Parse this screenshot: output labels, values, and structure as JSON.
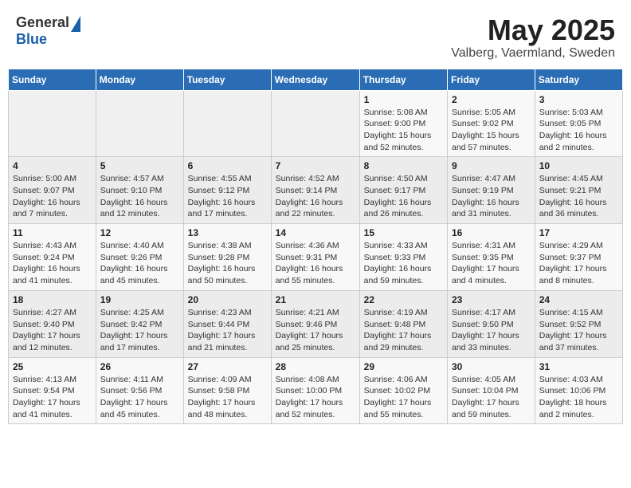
{
  "header": {
    "logo_general": "General",
    "logo_blue": "Blue",
    "title": "May 2025",
    "location": "Valberg, Vaermland, Sweden"
  },
  "days_of_week": [
    "Sunday",
    "Monday",
    "Tuesday",
    "Wednesday",
    "Thursday",
    "Friday",
    "Saturday"
  ],
  "weeks": [
    [
      {
        "day": "",
        "info": ""
      },
      {
        "day": "",
        "info": ""
      },
      {
        "day": "",
        "info": ""
      },
      {
        "day": "",
        "info": ""
      },
      {
        "day": "1",
        "info": "Sunrise: 5:08 AM\nSunset: 9:00 PM\nDaylight: 15 hours\nand 52 minutes."
      },
      {
        "day": "2",
        "info": "Sunrise: 5:05 AM\nSunset: 9:02 PM\nDaylight: 15 hours\nand 57 minutes."
      },
      {
        "day": "3",
        "info": "Sunrise: 5:03 AM\nSunset: 9:05 PM\nDaylight: 16 hours\nand 2 minutes."
      }
    ],
    [
      {
        "day": "4",
        "info": "Sunrise: 5:00 AM\nSunset: 9:07 PM\nDaylight: 16 hours\nand 7 minutes."
      },
      {
        "day": "5",
        "info": "Sunrise: 4:57 AM\nSunset: 9:10 PM\nDaylight: 16 hours\nand 12 minutes."
      },
      {
        "day": "6",
        "info": "Sunrise: 4:55 AM\nSunset: 9:12 PM\nDaylight: 16 hours\nand 17 minutes."
      },
      {
        "day": "7",
        "info": "Sunrise: 4:52 AM\nSunset: 9:14 PM\nDaylight: 16 hours\nand 22 minutes."
      },
      {
        "day": "8",
        "info": "Sunrise: 4:50 AM\nSunset: 9:17 PM\nDaylight: 16 hours\nand 26 minutes."
      },
      {
        "day": "9",
        "info": "Sunrise: 4:47 AM\nSunset: 9:19 PM\nDaylight: 16 hours\nand 31 minutes."
      },
      {
        "day": "10",
        "info": "Sunrise: 4:45 AM\nSunset: 9:21 PM\nDaylight: 16 hours\nand 36 minutes."
      }
    ],
    [
      {
        "day": "11",
        "info": "Sunrise: 4:43 AM\nSunset: 9:24 PM\nDaylight: 16 hours\nand 41 minutes."
      },
      {
        "day": "12",
        "info": "Sunrise: 4:40 AM\nSunset: 9:26 PM\nDaylight: 16 hours\nand 45 minutes."
      },
      {
        "day": "13",
        "info": "Sunrise: 4:38 AM\nSunset: 9:28 PM\nDaylight: 16 hours\nand 50 minutes."
      },
      {
        "day": "14",
        "info": "Sunrise: 4:36 AM\nSunset: 9:31 PM\nDaylight: 16 hours\nand 55 minutes."
      },
      {
        "day": "15",
        "info": "Sunrise: 4:33 AM\nSunset: 9:33 PM\nDaylight: 16 hours\nand 59 minutes."
      },
      {
        "day": "16",
        "info": "Sunrise: 4:31 AM\nSunset: 9:35 PM\nDaylight: 17 hours\nand 4 minutes."
      },
      {
        "day": "17",
        "info": "Sunrise: 4:29 AM\nSunset: 9:37 PM\nDaylight: 17 hours\nand 8 minutes."
      }
    ],
    [
      {
        "day": "18",
        "info": "Sunrise: 4:27 AM\nSunset: 9:40 PM\nDaylight: 17 hours\nand 12 minutes."
      },
      {
        "day": "19",
        "info": "Sunrise: 4:25 AM\nSunset: 9:42 PM\nDaylight: 17 hours\nand 17 minutes."
      },
      {
        "day": "20",
        "info": "Sunrise: 4:23 AM\nSunset: 9:44 PM\nDaylight: 17 hours\nand 21 minutes."
      },
      {
        "day": "21",
        "info": "Sunrise: 4:21 AM\nSunset: 9:46 PM\nDaylight: 17 hours\nand 25 minutes."
      },
      {
        "day": "22",
        "info": "Sunrise: 4:19 AM\nSunset: 9:48 PM\nDaylight: 17 hours\nand 29 minutes."
      },
      {
        "day": "23",
        "info": "Sunrise: 4:17 AM\nSunset: 9:50 PM\nDaylight: 17 hours\nand 33 minutes."
      },
      {
        "day": "24",
        "info": "Sunrise: 4:15 AM\nSunset: 9:52 PM\nDaylight: 17 hours\nand 37 minutes."
      }
    ],
    [
      {
        "day": "25",
        "info": "Sunrise: 4:13 AM\nSunset: 9:54 PM\nDaylight: 17 hours\nand 41 minutes."
      },
      {
        "day": "26",
        "info": "Sunrise: 4:11 AM\nSunset: 9:56 PM\nDaylight: 17 hours\nand 45 minutes."
      },
      {
        "day": "27",
        "info": "Sunrise: 4:09 AM\nSunset: 9:58 PM\nDaylight: 17 hours\nand 48 minutes."
      },
      {
        "day": "28",
        "info": "Sunrise: 4:08 AM\nSunset: 10:00 PM\nDaylight: 17 hours\nand 52 minutes."
      },
      {
        "day": "29",
        "info": "Sunrise: 4:06 AM\nSunset: 10:02 PM\nDaylight: 17 hours\nand 55 minutes."
      },
      {
        "day": "30",
        "info": "Sunrise: 4:05 AM\nSunset: 10:04 PM\nDaylight: 17 hours\nand 59 minutes."
      },
      {
        "day": "31",
        "info": "Sunrise: 4:03 AM\nSunset: 10:06 PM\nDaylight: 18 hours\nand 2 minutes."
      }
    ]
  ]
}
